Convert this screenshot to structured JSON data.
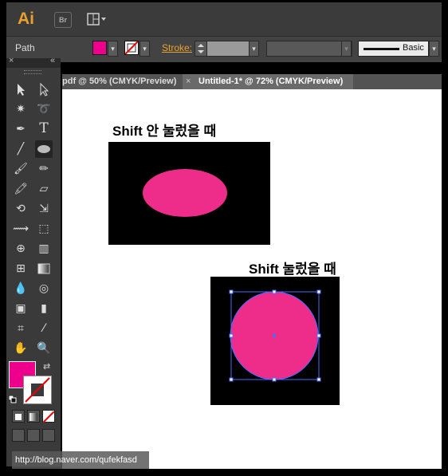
{
  "app": {
    "logo": "Ai",
    "bridge_label": "Br"
  },
  "control": {
    "object_label": "Path",
    "stroke_label": "Stroke:",
    "brush_label": "Basic"
  },
  "tabs": [
    {
      "label": "pdf @ 50% (CMYK/Preview)"
    },
    {
      "label": "Untitled-1* @ 72% (CMYK/Preview)",
      "close": "×"
    }
  ],
  "artboard": {
    "caption1": "Shift 안 눌렀을 때",
    "caption2": "Shift 눌렀을 때"
  },
  "colors": {
    "fill": "#ec008c",
    "shape_fill": "#ee2d8a",
    "selection": "#4a6cff",
    "accent": "#e8a031"
  },
  "toolbox": {
    "close": "×",
    "collapse": "«"
  },
  "watermark": "http://blog.naver.com/qufekfasd"
}
